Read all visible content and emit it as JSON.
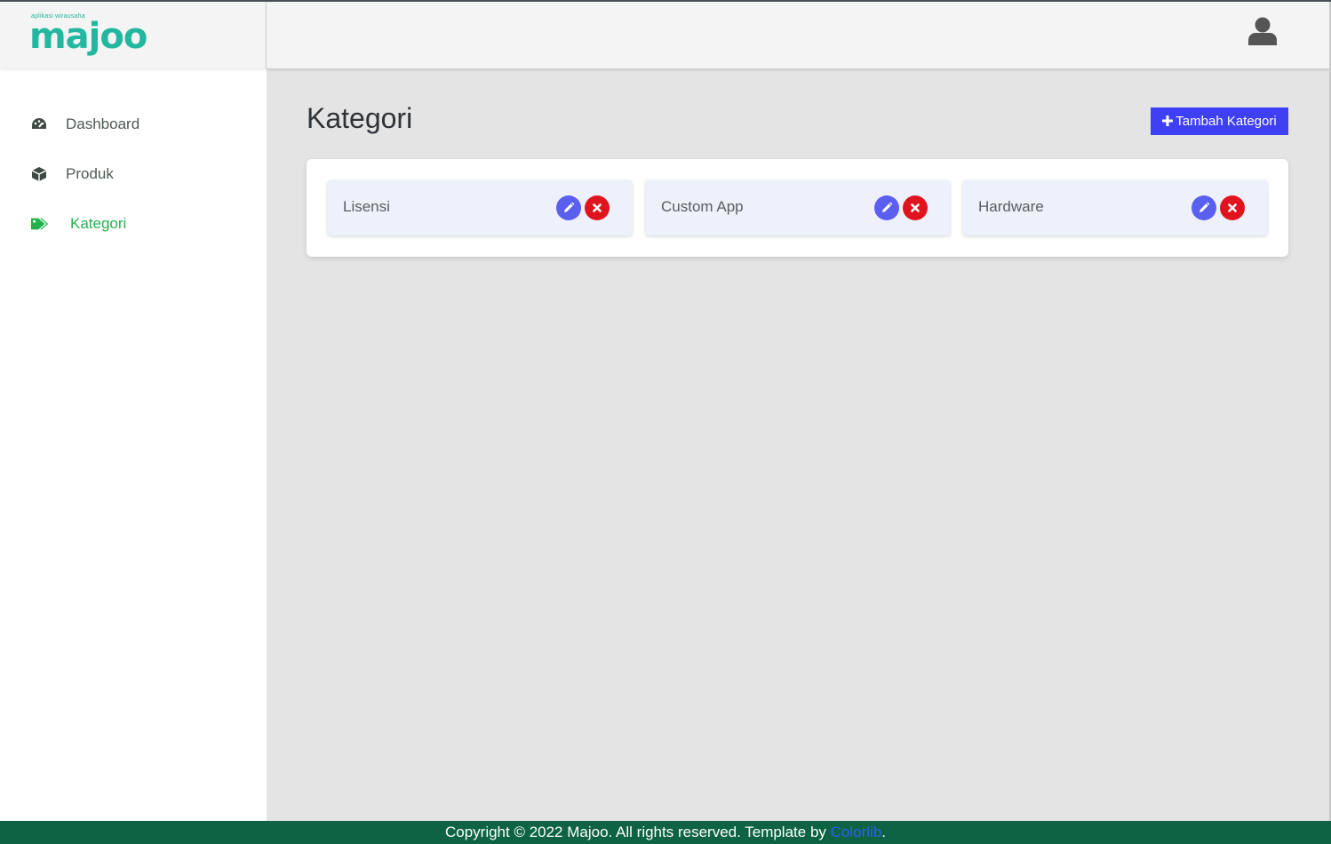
{
  "brand": {
    "tagline": "aplikasi wirausaha",
    "name": "majoo"
  },
  "sidebar": {
    "items": [
      {
        "label": "Dashboard",
        "icon": "tachometer-icon",
        "active": false
      },
      {
        "label": "Produk",
        "icon": "box-icon",
        "active": false
      },
      {
        "label": "Kategori",
        "icon": "tags-icon",
        "active": true
      }
    ]
  },
  "header": {
    "user_icon": "user-icon"
  },
  "main": {
    "title": "Kategori",
    "add_button": "Tambah Kategori",
    "categories": [
      {
        "name": "Lisensi"
      },
      {
        "name": "Custom App"
      },
      {
        "name": "Hardware"
      }
    ]
  },
  "footer": {
    "text": "Copyright © 2022 Majoo. All rights reserved. Template by ",
    "link": "Colorlib",
    "end": "."
  },
  "colors": {
    "accent": "#3f3ff5",
    "active_nav": "#22b24c",
    "edit": "#5a5ff0",
    "delete": "#e0141e",
    "footer_bg": "#0d6344",
    "brand": "#24b7a0"
  }
}
